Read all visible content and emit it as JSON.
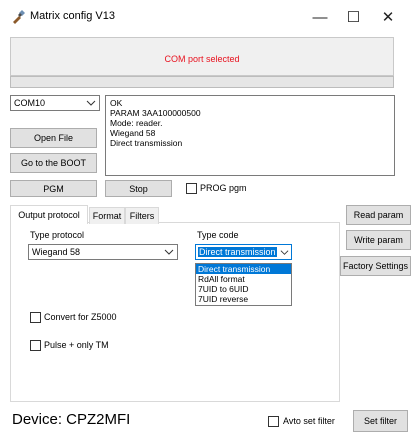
{
  "window": {
    "title": "Matrix config V13",
    "minimize_glyph": "—",
    "maximize_glyph": "☐",
    "close_glyph": "✕"
  },
  "status": {
    "message": "COM port selected",
    "message_color": "#e8121f"
  },
  "port_select": {
    "value": "COM10"
  },
  "buttons": {
    "open_file": "Open File",
    "go_boot": "Go to the BOOT",
    "pgm": "PGM",
    "stop": "Stop",
    "read_param": "Read param",
    "write_param": "Write param",
    "factory_settings": "Factory Settings",
    "set_filter": "Set filter"
  },
  "log": {
    "lines": [
      "OK",
      "PARAM  3AA100000500",
      "Mode: reader.",
      "Wiegand 58",
      "Direct transmission"
    ]
  },
  "prog_pgm": {
    "label": "PROG pgm",
    "checked": false
  },
  "tabs": [
    {
      "label": "Output protocol",
      "active": true
    },
    {
      "label": "Format",
      "active": false
    },
    {
      "label": "Filters",
      "active": false
    }
  ],
  "type_protocol": {
    "label": "Type protocol",
    "value": "Wiegand 58"
  },
  "type_code": {
    "label": "Type code",
    "value": "Direct transmission",
    "options": [
      "Direct transmission",
      "RdAll format",
      "7UID to 6UID",
      "7UID reverse"
    ],
    "selected_index": 0
  },
  "convert_z5000": {
    "label": "Convert for Z5000",
    "checked": false
  },
  "pulse_only_tm": {
    "label": "Pulse + only TM",
    "checked": false
  },
  "device": {
    "label": "Device: CPZ2MFI"
  },
  "avto_set_filter": {
    "label": "Avto set filter",
    "checked": false
  },
  "colors": {
    "accent": "#0078d7",
    "button_face": "#e1e1e1"
  }
}
